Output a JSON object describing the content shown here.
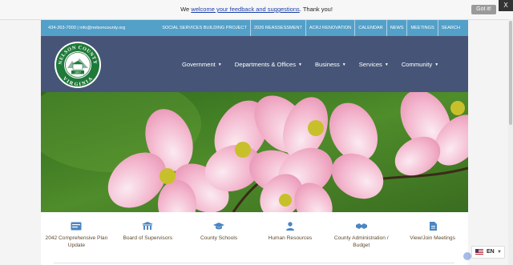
{
  "notice": {
    "prefix": "We",
    "link": "welcome your feedback and suggestions",
    "suffix": ". Thank you!",
    "button": "Got it!",
    "close": "X"
  },
  "topbar": {
    "contact": "434-263-7000 | info@nelsoncounty.org",
    "links": [
      "SOCIAL SERVICES BUILDING PROJECT",
      "2026 REASSESSMENT",
      "ACRJ RENOVATION",
      "CALENDAR",
      "NEWS",
      "MEETINGS",
      "SEARCH"
    ]
  },
  "seal": {
    "top_text": "NELSON COUNTY",
    "bottom_text": "VIRGINIA",
    "center_text": "1807"
  },
  "nav": [
    {
      "label": "Government"
    },
    {
      "label": "Departments & Offices"
    },
    {
      "label": "Business"
    },
    {
      "label": "Services"
    },
    {
      "label": "Community"
    }
  ],
  "quick_links": [
    {
      "label": "2042 Comprehensive Plan Update",
      "icon": "document-card-icon"
    },
    {
      "label": "Board of Supervisors",
      "icon": "building-icon"
    },
    {
      "label": "County Schools",
      "icon": "graduation-cap-icon"
    },
    {
      "label": "Human Resources",
      "icon": "person-icon"
    },
    {
      "label": "County Administration / Budget",
      "icon": "handshake-icon"
    },
    {
      "label": "View/Join Meetings",
      "icon": "file-icon"
    }
  ],
  "language": {
    "code": "EN"
  },
  "colors": {
    "topbar": "#53a0c9",
    "header": "#465577",
    "icon": "#4a86c2",
    "quick_label": "#5d4a2e"
  }
}
